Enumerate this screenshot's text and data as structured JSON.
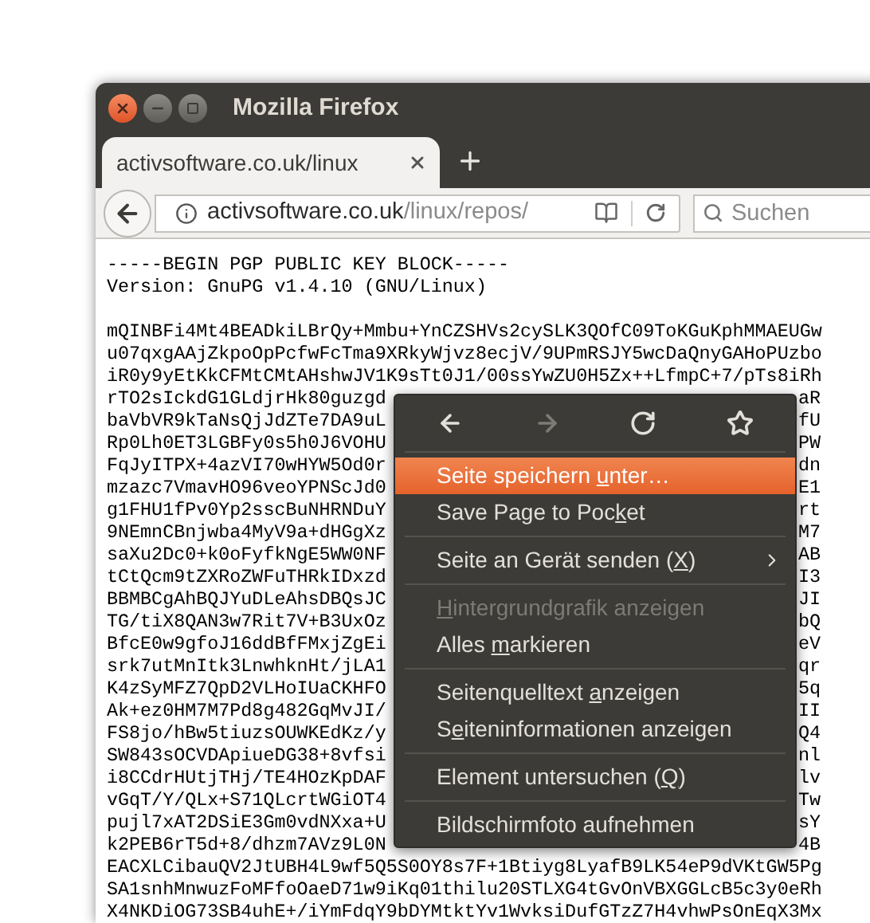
{
  "window": {
    "title": "Mozilla Firefox"
  },
  "tabs": [
    {
      "title": "activsoftware.co.uk/linux",
      "selected": true
    }
  ],
  "url_bar": {
    "domain": "activsoftware.co.uk",
    "path": "/linux/repos/"
  },
  "search": {
    "placeholder": "Suchen"
  },
  "page": {
    "header": [
      "-----BEGIN PGP PUBLIC KEY BLOCK-----",
      "Version: GnuPG v1.4.10 (GNU/Linux)"
    ],
    "key_lines": [
      {
        "left": "mQINBFi4Mt4BEADkiLBrQy+Mmbu+YnCZSHVs2cySLK3QOfC09ToKGuKphMMAEUGw"
      },
      {
        "left": "u07qxgAAjZkpoOpPcfwFcTma9XRkyWjvz8ecjV/9UPmRSJY5wcDaQnyGAHoPUzbo"
      },
      {
        "left": "iR0y9yEtKkCFMtCMtAHshwJV1K9sTt0J1/00ssYwZU0H5Zx++LfmpC+7/pTs8iRh"
      },
      {
        "left": "rTO2sIckdG1GLdjrHk80guzgd",
        "right": "aR"
      },
      {
        "left": "baVbVR9kTaNsQjJdZTe7DA9uL",
        "right": "fU"
      },
      {
        "left": "Rp0Lh0ET3LGBFy0s5h0J6VOHU",
        "right": "PW"
      },
      {
        "left": "FqJyITPX+4azVI70wHYW5Od0r",
        "right": "dn"
      },
      {
        "left": "mzazc7VmavHO96veoYPNScJd0",
        "right": "E1"
      },
      {
        "left": "g1FHU1fPv0Yp2sscBuNHRNDuY",
        "right": "rt"
      },
      {
        "left": "9NEmnCBnjwba4MyV9a+dHGgXz",
        "right": "M7"
      },
      {
        "left": "saXu2Dc0+k0oFyfkNgE5WW0NF",
        "right": "AB"
      },
      {
        "left": "tCtQcm9tZXRoZWFuTHRkIDxzd",
        "right": "I3"
      },
      {
        "left": "BBMBCgAhBQJYuDLeAhsDBQsJC",
        "right": "JI"
      },
      {
        "left": "TG/tiX8QAN3w7Rit7V+B3UxOz",
        "right": "bQ"
      },
      {
        "left": "BfcE0w9gfoJ16ddBfFMxjZgEi",
        "right": "eV"
      },
      {
        "left": "srk7utMnItk3LnwhknHt/jLA1",
        "right": "qr"
      },
      {
        "left": "K4zSyMFZ7QpD2VLHoIUaCKHFO",
        "right": "5q"
      },
      {
        "left": "Ak+ez0HM7M7Pd8g482GqMvJI/",
        "right": "II"
      },
      {
        "left": "FS8jo/hBw5tiuzsOUWKEdKz/y",
        "right": "Q4"
      },
      {
        "left": "SW843sOCVDApiueDG38+8vfsi",
        "right": "nl"
      },
      {
        "left": "i8CCdrHUtjTHj/TE4HOzKpDAF",
        "right": "lv"
      },
      {
        "left": "vGqT/Y/QLx+S71QLcrtWGiOT4",
        "right": "Tw"
      },
      {
        "left": "pujl7xAT2DSiE3Gm0vdNXxa+U",
        "right": "sY"
      },
      {
        "left": "k2PEB6rT5d+8/dhzm7AVz9L0N",
        "right": "4B"
      },
      {
        "left": "EACXLCibauQV2JtUBH4L9wf5Q5S0OY8s7F+1Btiyg8LyafB9LK54eP9dVKtGW5Pg"
      },
      {
        "left": "SA1snhMnwuzFoMFfoOaeD71w9iKq01thilu20STLXG4tGvOnVBXGGLcB5c3y0eRh"
      },
      {
        "left": "X4NKDiOG73SB4uhE+/iYmFdqY9bDYMtktYv1WvksiDufGTzZ7H4vhwPsOnEqX3Mx"
      }
    ]
  },
  "context_menu": {
    "nav_buttons": [
      {
        "disabled": false
      },
      {
        "disabled": true
      },
      {
        "disabled": false
      },
      {
        "disabled": false
      }
    ],
    "entries": [
      {
        "kind": "separator"
      },
      {
        "kind": "item",
        "label": [
          {
            "text": "Seite speichern "
          },
          {
            "text": "u",
            "underlined": true
          },
          {
            "text": "nter…"
          }
        ],
        "selected": true,
        "disabled": false,
        "submenu": false
      },
      {
        "kind": "item",
        "label": [
          {
            "text": "Save Page to Poc"
          },
          {
            "text": "k",
            "underlined": true
          },
          {
            "text": "et"
          }
        ],
        "selected": false,
        "disabled": false,
        "submenu": false
      },
      {
        "kind": "separator"
      },
      {
        "kind": "item",
        "label": [
          {
            "text": "Seite an Gerät senden ("
          },
          {
            "text": "X",
            "underlined": true
          },
          {
            "text": ")"
          }
        ],
        "selected": false,
        "disabled": false,
        "submenu": true
      },
      {
        "kind": "separator"
      },
      {
        "kind": "item",
        "label": [
          {
            "text": "H",
            "underlined": true
          },
          {
            "text": "intergrundgrafik anzeigen"
          }
        ],
        "selected": false,
        "disabled": true,
        "submenu": false
      },
      {
        "kind": "item",
        "label": [
          {
            "text": "Alles "
          },
          {
            "text": "m",
            "underlined": true
          },
          {
            "text": "arkieren"
          }
        ],
        "selected": false,
        "disabled": false,
        "submenu": false
      },
      {
        "kind": "separator"
      },
      {
        "kind": "item",
        "label": [
          {
            "text": "Seitenquelltext "
          },
          {
            "text": "a",
            "underlined": true
          },
          {
            "text": "nzeigen"
          }
        ],
        "selected": false,
        "disabled": false,
        "submenu": false
      },
      {
        "kind": "item",
        "label": [
          {
            "text": "S"
          },
          {
            "text": "e",
            "underlined": true
          },
          {
            "text": "iteninformationen anzeigen"
          }
        ],
        "selected": false,
        "disabled": false,
        "submenu": false
      },
      {
        "kind": "separator"
      },
      {
        "kind": "item",
        "label": [
          {
            "text": "Element untersuchen ("
          },
          {
            "text": "Q",
            "underlined": true
          },
          {
            "text": ")"
          }
        ],
        "selected": false,
        "disabled": false,
        "submenu": false
      },
      {
        "kind": "separator"
      },
      {
        "kind": "item",
        "label": [
          {
            "text": "Bildschirmfoto aufnehmen",
            "underlined": false
          }
        ],
        "selected": false,
        "disabled": false,
        "submenu": false
      }
    ]
  }
}
